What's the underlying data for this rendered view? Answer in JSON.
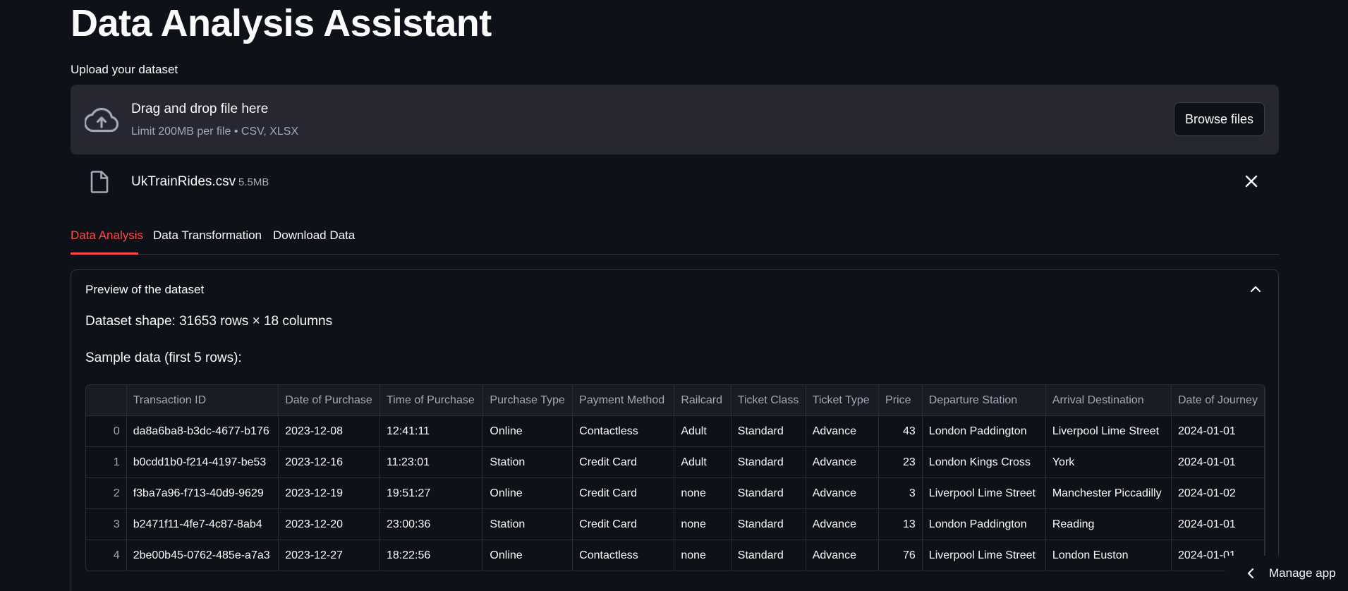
{
  "page": {
    "title": "Data Analysis Assistant"
  },
  "uploader": {
    "label": "Upload your dataset",
    "drop_title": "Drag and drop file here",
    "drop_subtitle": "Limit 200MB per file • CSV, XLSX",
    "browse_label": "Browse files",
    "icon": "cloud-upload-icon"
  },
  "uploaded_file": {
    "name": "UkTrainRides.csv",
    "size": "5.5MB",
    "icon": "file-icon"
  },
  "tabs": [
    {
      "label": "Data Analysis",
      "active": true
    },
    {
      "label": "Data Transformation",
      "active": false
    },
    {
      "label": "Download Data",
      "active": false
    }
  ],
  "expander": {
    "title": "Preview of the dataset",
    "shape_text": "Dataset shape: 31653 rows × 18 columns",
    "sample_text": "Sample data (first 5 rows):"
  },
  "table": {
    "columns": [
      "",
      "Transaction ID",
      "Date of Purchase",
      "Time of Purchase",
      "Purchase Type",
      "Payment Method",
      "Railcard",
      "Ticket Class",
      "Ticket Type",
      "Price",
      "Departure Station",
      "Arrival Destination",
      "Date of Journey"
    ],
    "rows": [
      [
        "0",
        "da8a6ba8-b3dc-4677-b176",
        "2023-12-08",
        "12:41:11",
        "Online",
        "Contactless",
        "Adult",
        "Standard",
        "Advance",
        "43",
        "London Paddington",
        "Liverpool Lime Street",
        "2024-01-01"
      ],
      [
        "1",
        "b0cdd1b0-f214-4197-be53",
        "2023-12-16",
        "11:23:01",
        "Station",
        "Credit Card",
        "Adult",
        "Standard",
        "Advance",
        "23",
        "London Kings Cross",
        "York",
        "2024-01-01"
      ],
      [
        "2",
        "f3ba7a96-f713-40d9-9629",
        "2023-12-19",
        "19:51:27",
        "Online",
        "Credit Card",
        "none",
        "Standard",
        "Advance",
        "3",
        "Liverpool Lime Street",
        "Manchester Piccadilly",
        "2024-01-02"
      ],
      [
        "3",
        "b2471f11-4fe7-4c87-8ab4",
        "2023-12-20",
        "23:00:36",
        "Station",
        "Credit Card",
        "none",
        "Standard",
        "Advance",
        "13",
        "London Paddington",
        "Reading",
        "2024-01-01"
      ],
      [
        "4",
        "2be00b45-0762-485e-a7a3",
        "2023-12-27",
        "18:22:56",
        "Online",
        "Contactless",
        "none",
        "Standard",
        "Advance",
        "76",
        "Liverpool Lime Street",
        "London Euston",
        "2024-01-01"
      ]
    ]
  },
  "manage_app": {
    "label": "Manage app"
  },
  "colors": {
    "background": "#0e1117",
    "accent": "#ff4b4b",
    "surface": "#262730",
    "muted_text": "#a3a8b8"
  }
}
